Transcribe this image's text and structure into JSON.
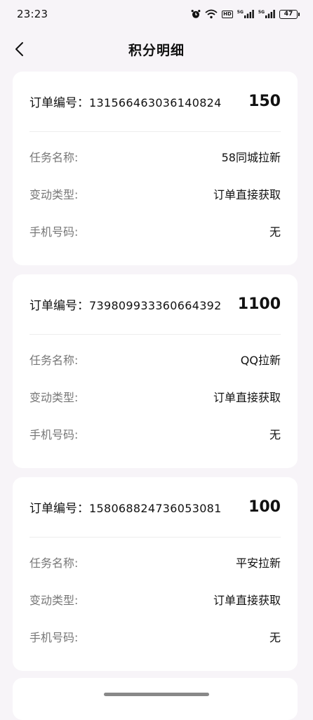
{
  "status_bar": {
    "time": "23:23",
    "hd_label": "HD",
    "net1_label": "5G",
    "net2_label": "5G",
    "battery": "47"
  },
  "nav": {
    "title": "积分明细",
    "back_icon": "chevron-left-icon"
  },
  "labels": {
    "order": "订单编号：",
    "task": "任务名称:",
    "change_type": "变动类型:",
    "phone": "手机号码:"
  },
  "records": [
    {
      "order_no": "1315664630361408​24",
      "points": "150",
      "task_name": "58同城拉新",
      "change_type": "订单直接获取",
      "phone": "无"
    },
    {
      "order_no": "739809933360664392",
      "points": "1100",
      "task_name": "QQ拉新",
      "change_type": "订单直接获取",
      "phone": "无"
    },
    {
      "order_no": "158068824736053081",
      "points": "100",
      "task_name": "平安拉新",
      "change_type": "订单直接获取",
      "phone": "无"
    }
  ]
}
